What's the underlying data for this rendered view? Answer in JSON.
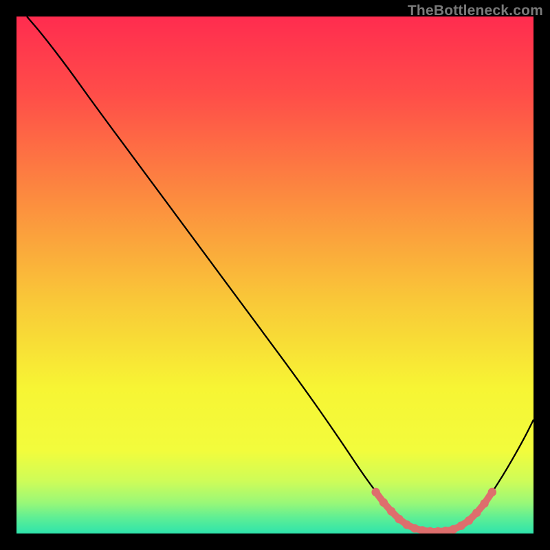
{
  "attribution": "TheBottleneck.com",
  "chart_data": {
    "type": "line",
    "title": "",
    "xlabel": "",
    "ylabel": "",
    "xlim": [
      0,
      100
    ],
    "ylim": [
      0,
      100
    ],
    "gradient_stops": [
      {
        "offset": 0.0,
        "color": "#FF2C4F"
      },
      {
        "offset": 0.15,
        "color": "#FF4D49"
      },
      {
        "offset": 0.35,
        "color": "#FC8B3F"
      },
      {
        "offset": 0.55,
        "color": "#F9C838"
      },
      {
        "offset": 0.72,
        "color": "#F7F534"
      },
      {
        "offset": 0.84,
        "color": "#F2FC3C"
      },
      {
        "offset": 0.9,
        "color": "#CDFC59"
      },
      {
        "offset": 0.94,
        "color": "#9AF877"
      },
      {
        "offset": 0.97,
        "color": "#5DEE95"
      },
      {
        "offset": 1.0,
        "color": "#2FE4AC"
      }
    ],
    "series": [
      {
        "name": "bottleneck-curve",
        "points": [
          {
            "x": 2.0,
            "y": 100.0
          },
          {
            "x": 5.0,
            "y": 96.5
          },
          {
            "x": 10.0,
            "y": 90.0
          },
          {
            "x": 15.0,
            "y": 83.0
          },
          {
            "x": 25.0,
            "y": 69.5
          },
          {
            "x": 35.0,
            "y": 56.0
          },
          {
            "x": 45.0,
            "y": 42.5
          },
          {
            "x": 55.0,
            "y": 29.0
          },
          {
            "x": 62.0,
            "y": 19.0
          },
          {
            "x": 68.0,
            "y": 10.0
          },
          {
            "x": 72.0,
            "y": 5.0
          },
          {
            "x": 75.0,
            "y": 2.0
          },
          {
            "x": 78.0,
            "y": 0.6
          },
          {
            "x": 81.0,
            "y": 0.4
          },
          {
            "x": 84.0,
            "y": 0.6
          },
          {
            "x": 87.0,
            "y": 2.0
          },
          {
            "x": 90.0,
            "y": 5.0
          },
          {
            "x": 94.0,
            "y": 11.0
          },
          {
            "x": 98.0,
            "y": 18.0
          },
          {
            "x": 100.0,
            "y": 22.0
          }
        ]
      }
    ],
    "highlight": {
      "name": "optimal-range",
      "color": "#DE6E6D",
      "points": [
        {
          "x": 69.5,
          "y": 8.0
        },
        {
          "x": 71.0,
          "y": 6.0
        },
        {
          "x": 72.5,
          "y": 4.3
        },
        {
          "x": 74.0,
          "y": 2.8
        },
        {
          "x": 75.5,
          "y": 1.7
        },
        {
          "x": 77.0,
          "y": 1.0
        },
        {
          "x": 78.5,
          "y": 0.6
        },
        {
          "x": 80.0,
          "y": 0.4
        },
        {
          "x": 81.5,
          "y": 0.4
        },
        {
          "x": 83.0,
          "y": 0.5
        },
        {
          "x": 84.5,
          "y": 0.8
        },
        {
          "x": 86.0,
          "y": 1.5
        },
        {
          "x": 87.5,
          "y": 2.5
        },
        {
          "x": 89.0,
          "y": 4.0
        },
        {
          "x": 90.5,
          "y": 5.8
        },
        {
          "x": 92.0,
          "y": 8.0
        }
      ]
    }
  }
}
